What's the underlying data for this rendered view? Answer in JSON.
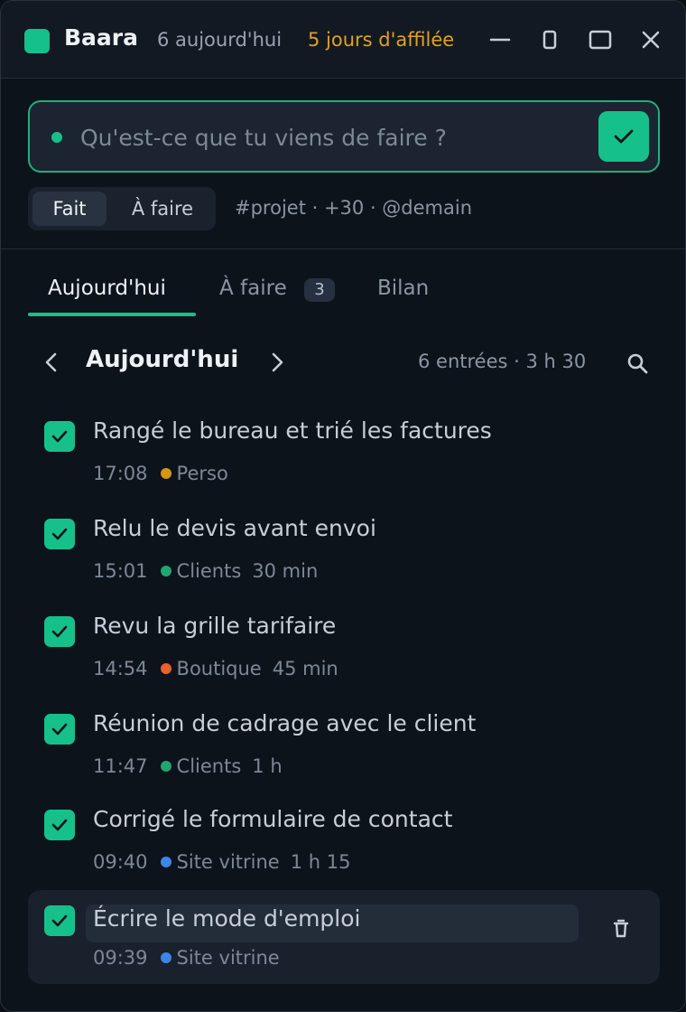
{
  "titlebar": {
    "app_name": "Baara",
    "today_count": "6 aujourd'hui",
    "streak": "5 jours d'affilée",
    "logo_color": "#16c08a",
    "buttons": [
      "minimize-icon",
      "compact-icon",
      "maximize-icon",
      "close-icon"
    ]
  },
  "composer": {
    "placeholder": "Qu'est-ce que tu viens de faire ?",
    "value": "",
    "submit_icon": "checkmark-icon"
  },
  "mode": {
    "options": [
      "Fait",
      "À faire"
    ],
    "selected": "Fait",
    "hint": "#projet · +30 · @demain"
  },
  "tabs": [
    {
      "label": "Aujourd'hui",
      "active": true
    },
    {
      "label": "À faire",
      "badge": "3"
    },
    {
      "label": "Bilan"
    }
  ],
  "day": {
    "title": "Aujourd'hui",
    "summary": "6 entrées · 3 h 30"
  },
  "colors": {
    "accent": "#16c08a",
    "perso": "#d4970f",
    "clients": "#1fa672",
    "boutique": "#e8612c",
    "site_vitrine": "#3d86e6"
  },
  "entries": [
    {
      "text": "Rangé le bureau et trié les factures",
      "time": "17:08",
      "tag": "Perso",
      "tag_color": "#d4970f",
      "duration": ""
    },
    {
      "text": "Relu le devis avant envoi",
      "time": "15:01",
      "tag": "Clients",
      "tag_color": "#1fa672",
      "duration": "30 min"
    },
    {
      "text": "Revu la grille tarifaire",
      "time": "14:54",
      "tag": "Boutique",
      "tag_color": "#e8612c",
      "duration": "45 min"
    },
    {
      "text": "Réunion de cadrage avec le client",
      "time": "11:47",
      "tag": "Clients",
      "tag_color": "#1fa672",
      "duration": "1 h"
    },
    {
      "text": "Corrigé le formulaire de contact",
      "time": "09:40",
      "tag": "Site vitrine",
      "tag_color": "#3d86e6",
      "duration": "1 h 15"
    },
    {
      "text": "Écrire le mode d'emploi",
      "time": "09:39",
      "tag": "Site vitrine",
      "tag_color": "#3d86e6",
      "duration": "",
      "selected": true
    }
  ]
}
